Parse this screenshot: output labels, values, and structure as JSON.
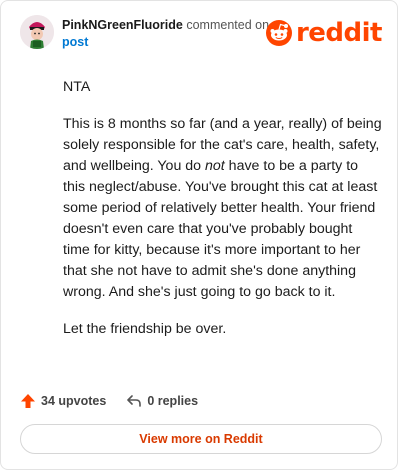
{
  "header": {
    "username": "PinkNGreenFluoride",
    "action_text": "commented on",
    "post_link": "post",
    "brand": "reddit",
    "brand_color": "#ff4500"
  },
  "comment": {
    "paragraphs": [
      {
        "text": "NTA"
      },
      {
        "before": "This is 8 months so far (and a year, really) of being solely responsible for the cat's care, health, safety, and wellbeing. You do ",
        "emphasis": "not",
        "after": " have to be a party to this neglect/abuse. You've brought this cat at least some period of relatively better health. Your friend doesn't even care that you've probably bought time for kitty, because it's more important to her that she not have to admit she's done anything wrong. And she's just going to go back to it."
      },
      {
        "text": "Let the friendship be over."
      }
    ]
  },
  "footer": {
    "upvotes": "34 upvotes",
    "replies": "0 replies",
    "upvote_icon": "arrow-up-icon",
    "reply_icon": "reply-arrow-icon"
  },
  "view_more": {
    "label": "View more on Reddit"
  }
}
